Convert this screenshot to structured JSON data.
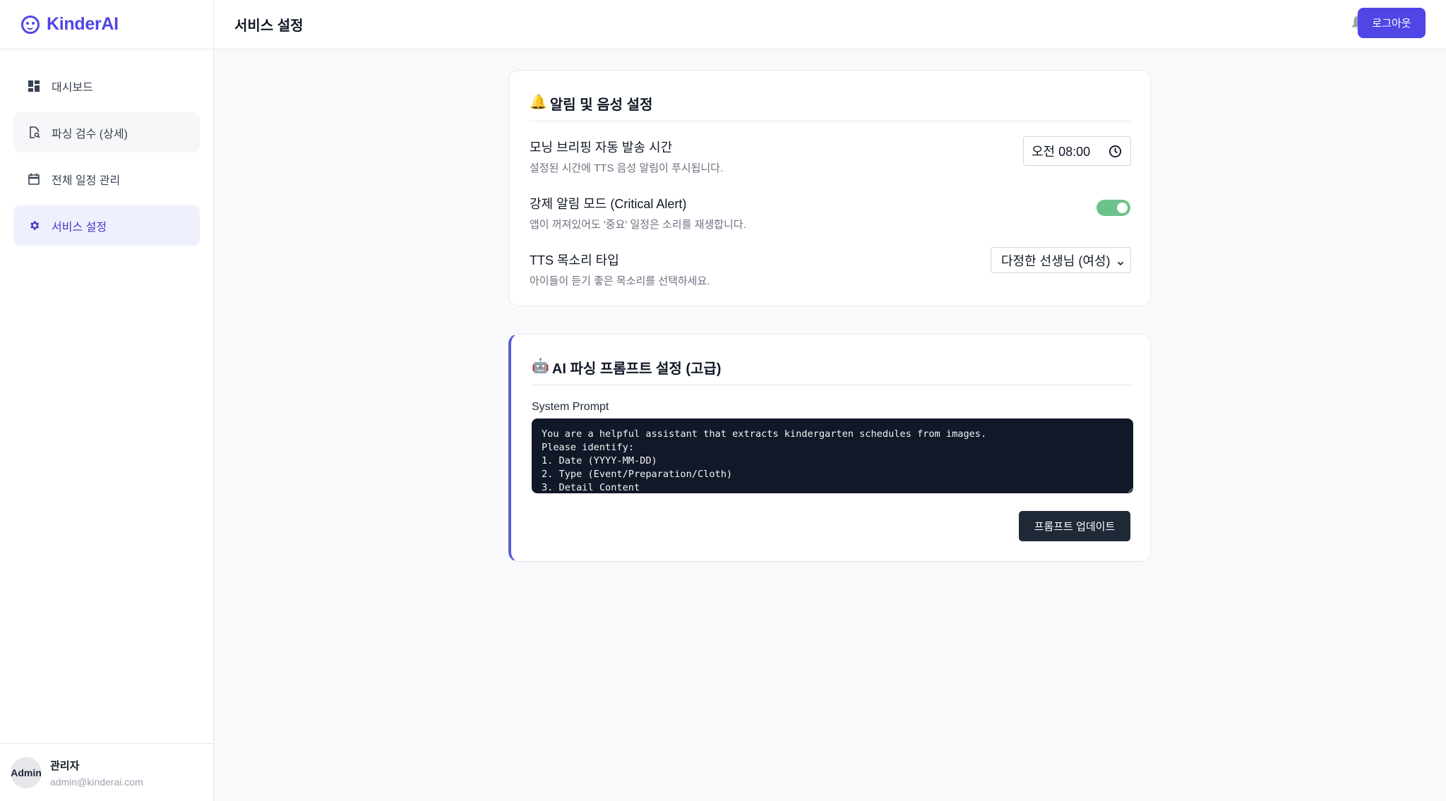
{
  "app": {
    "name": "KinderAI",
    "accent": "#4f46e5"
  },
  "sidebar": {
    "items": [
      {
        "label": "대시보드",
        "icon": "dashboard-icon"
      },
      {
        "label": "파싱 검수 (상세)",
        "icon": "document-search-icon"
      },
      {
        "label": "전체 일정 관리",
        "icon": "calendar-icon"
      },
      {
        "label": "서비스 설정",
        "icon": "gear-icon",
        "active": true
      }
    ],
    "user": {
      "avatar_text": "Admin",
      "name": "관리자",
      "email": "admin@kinderai.com"
    }
  },
  "header": {
    "title": "서비스 설정",
    "logout_label": "로그아웃"
  },
  "notifications": {
    "title_emoji": "🔔",
    "title": "알림 및 음성 설정",
    "morning": {
      "label": "모닝 브리핑 자동 발송 시간",
      "desc": "설정된 시간에 TTS 음성 알림이 푸시됩니다.",
      "value": "오전 08:00"
    },
    "critical": {
      "label": "강제 알림 모드 (Critical Alert)",
      "desc": "앱이 꺼져있어도 '중요' 일정은 소리를 재생합니다.",
      "enabled": true
    },
    "tts": {
      "label": "TTS 목소리 타입",
      "desc": "아이들이 듣기 좋은 목소리를 선택하세요.",
      "selected": "다정한 선생님 (여성)"
    }
  },
  "ai": {
    "title_emoji": "🤖",
    "title": "AI 파싱 프롬프트 설정 (고급)",
    "prompt_label": "System Prompt",
    "prompt_value": "You are a helpful assistant that extracts kindergarten schedules from images.\nPlease identify:\n1. Date (YYYY-MM-DD)\n2. Type (Event/Preparation/Cloth)\n3. Detail Content",
    "update_label": "프롬프트 업데이트"
  }
}
